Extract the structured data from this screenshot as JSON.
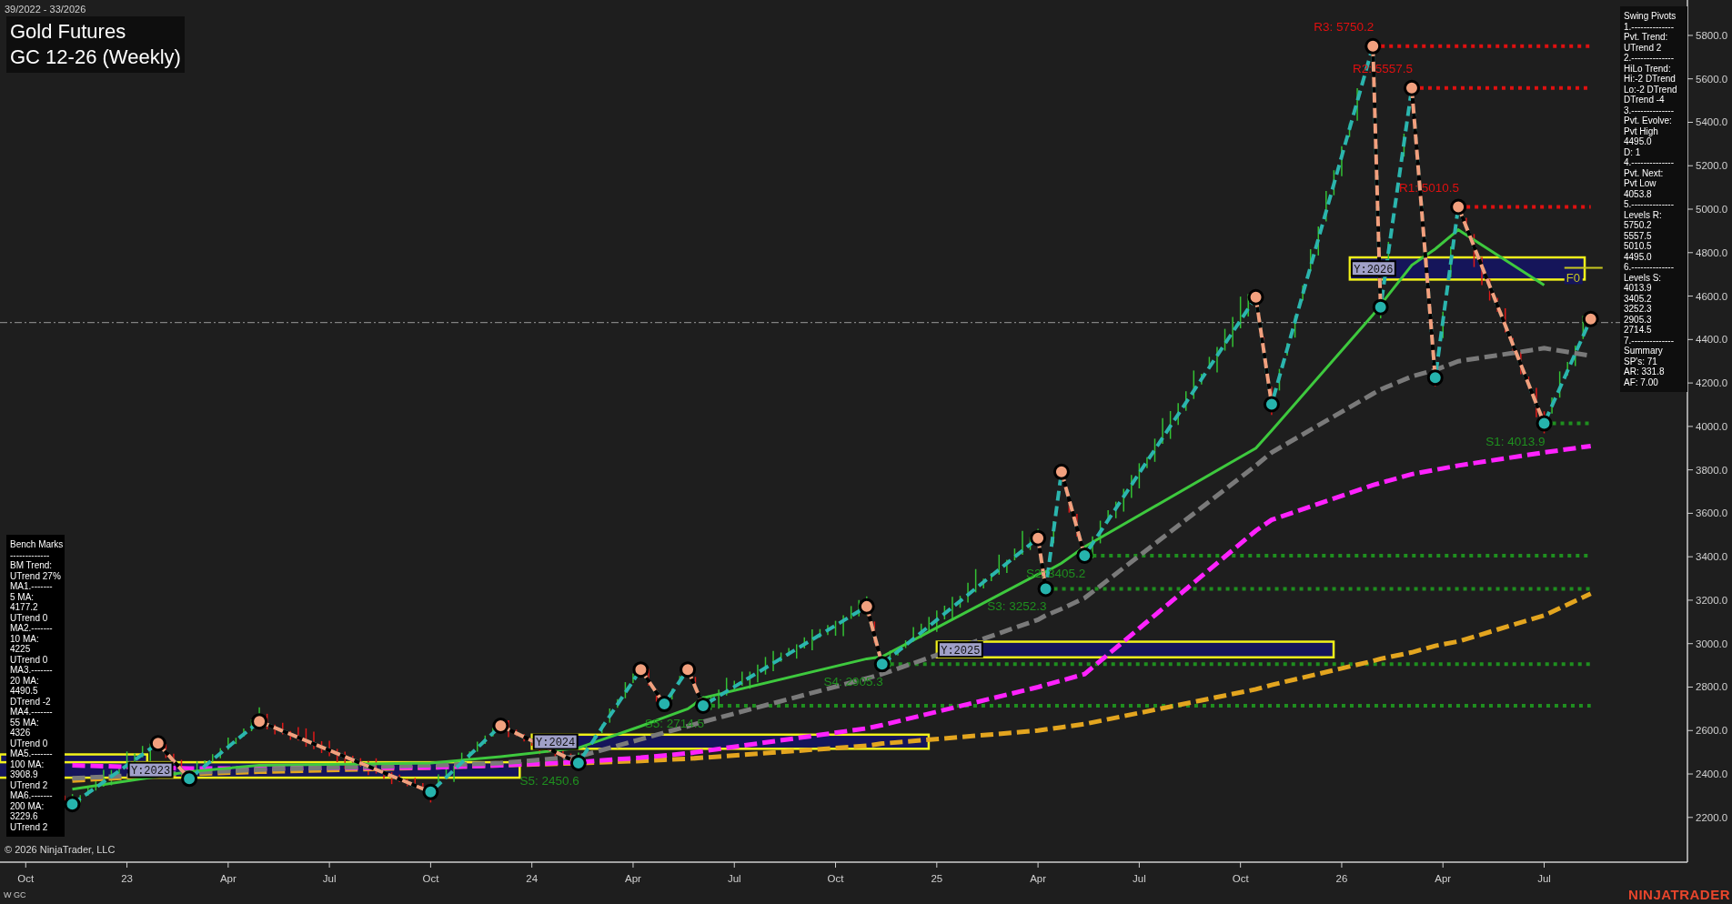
{
  "date_range": "39/2022 - 33/2026",
  "title": {
    "name": "Gold Futures",
    "contract": "GC 12-26 (Weekly)"
  },
  "swing_pivots": [
    "Swing Pivots",
    "1.--------------",
    "Pvt. Trend:",
    "UTrend 2",
    "2.--------------",
    "HiLo Trend:",
    "Hi:-2 DTrend",
    "Lo:-2 DTrend",
    "DTrend -4",
    "3.--------------",
    "Pvt. Evolve:",
    "Pvt High",
    "4495.0",
    "D: 1",
    "4.--------------",
    "Pvt. Next:",
    "Pvt Low",
    "4053.8",
    "5.--------------",
    "Levels R:",
    "5750.2",
    "5557.5",
    "5010.5",
    "4495.0",
    "6.--------------",
    "Levels S:",
    "4013.9",
    "3405.2",
    "3252.3",
    "2905.3",
    "2714.5",
    "7.--------------",
    "Summary",
    "SP's: 71",
    "AR: 331.8",
    "AF: 7.00"
  ],
  "bench_marks": [
    "Bench Marks",
    "-------------",
    "BM Trend:",
    "UTrend 27%",
    "MA1.-------",
    "5 MA:",
    "4177.2",
    "UTrend 0",
    "MA2.-------",
    "10 MA:",
    "4225",
    "UTrend 0",
    "MA3.-------",
    "20 MA:",
    "4490.5",
    "DTrend -2",
    "MA4.-------",
    "55 MA:",
    "4326",
    "UTrend 0",
    "MA5.-------",
    "100 MA:",
    "3908.9",
    "UTrend 2",
    "MA6.-------",
    "200 MA:",
    "3229.6",
    "UTrend 2"
  ],
  "chart": {
    "chart_data": {
      "type": "line",
      "x": [
        22.865,
        23.077,
        23.154,
        23.327,
        23.75,
        23.923,
        24.115,
        24.269,
        24.327,
        24.385,
        24.423,
        24.827,
        24.865,
        25.25,
        25.269,
        25.308,
        25.365,
        25.788,
        25.827,
        26.077,
        26.096,
        26.173,
        26.231,
        26.288,
        26.5,
        26.615
      ],
      "series": [
        {
          "color": "#2bb5ae",
          "line_style": "dashed",
          "marker": "o",
          "values": [
            2261,
            2541,
            2378,
            2642,
            2317,
            2622,
            2450.6,
            2881,
            2722,
            2881,
            2714.5,
            3171,
            2905.3,
            3486,
            3252.3,
            3791,
            3405.2,
            4595,
            4102,
            5750.2,
            4549,
            5557.5,
            4224,
            5010.5,
            4013.9,
            4495
          ]
        },
        {
          "color": "#3ec93e",
          "line_style": "solid",
          "values": [
            2330,
            null,
            2410,
            2440,
            2450,
            2480,
            2520,
            2620,
            2660,
            2700,
            2750,
            2930,
            2940,
            3320,
            3330,
            3370,
            3446,
            3900,
            3980,
            4513,
            4560,
            4742,
            4817,
            4905,
            4650,
            null
          ]
        },
        {
          "color": "#7a7a7a",
          "line_style": "dashed",
          "values": [
            2380,
            null,
            2405,
            2420,
            2440,
            2450,
            2480,
            2560,
            2590,
            2620,
            2640,
            2840,
            2860,
            3110,
            3130,
            3160,
            3210,
            3820,
            3880,
            4150,
            4170,
            4230,
            4260,
            4300,
            4360,
            4325
          ]
        },
        {
          "color": "#ff22ff",
          "line_style": "dashed",
          "values": [
            2440,
            null,
            2425,
            null,
            2430,
            2440,
            2455,
            2475,
            2485,
            2495,
            2505,
            2610,
            2625,
            2800,
            2810,
            2830,
            2860,
            3520,
            3570,
            3730,
            3740,
            3780,
            3800,
            3820,
            3880,
            3910
          ]
        },
        {
          "color": "#e3a51f",
          "line_style": "dashed",
          "values": [
            2370,
            null,
            2400,
            2410,
            2430,
            2440,
            2450,
            2460,
            2465,
            2470,
            2475,
            2530,
            2540,
            2600,
            2605,
            2615,
            2630,
            2790,
            2810,
            2920,
            2930,
            2960,
            2990,
            3010,
            3130,
            3230
          ]
        }
      ],
      "ref_lines": [
        {
          "axis": "y",
          "value": 4478,
          "color": "#9a9a9a",
          "line_style": "dashdot"
        }
      ],
      "xlim": [
        22.6865,
        26.8538
      ],
      "ylim": [
        1994,
        5963
      ],
      "xticks": [
        {
          "value": 22.75,
          "label": "Oct"
        },
        {
          "value": 23,
          "label": "23"
        },
        {
          "value": 23.25,
          "label": "Apr"
        },
        {
          "value": 23.5,
          "label": "Jul"
        },
        {
          "value": 23.75,
          "label": "Oct"
        },
        {
          "value": 24,
          "label": "24"
        },
        {
          "value": 24.25,
          "label": "Apr"
        },
        {
          "value": 24.5,
          "label": "Jul"
        },
        {
          "value": 24.75,
          "label": "Oct"
        },
        {
          "value": 25,
          "label": "25"
        },
        {
          "value": 25.25,
          "label": "Apr"
        },
        {
          "value": 25.5,
          "label": "Jul"
        },
        {
          "value": 25.75,
          "label": "Oct"
        },
        {
          "value": 26,
          "label": "26"
        },
        {
          "value": 26.25,
          "label": "Apr"
        },
        {
          "value": 26.5,
          "label": "Jul"
        }
      ],
      "yticks": [
        {
          "value": 2200,
          "label": "2200.0"
        },
        {
          "value": 2400,
          "label": "2400.0"
        },
        {
          "value": 2600,
          "label": "2600.0"
        },
        {
          "value": 2800,
          "label": "2800.0"
        },
        {
          "value": 3000,
          "label": "3000.0"
        },
        {
          "value": 3200,
          "label": "3200.0"
        },
        {
          "value": 3400,
          "label": "3400.0"
        },
        {
          "value": 3600,
          "label": "3600.0"
        },
        {
          "value": 3800,
          "label": "3800.0"
        },
        {
          "value": 4000,
          "label": "4000.0"
        },
        {
          "value": 4200,
          "label": "4200.0"
        },
        {
          "value": 4400,
          "label": "4400.0"
        },
        {
          "value": 4600,
          "label": "4600.0"
        },
        {
          "value": 4800,
          "label": "4800.0"
        },
        {
          "value": 5000,
          "label": "5000.0"
        },
        {
          "value": 5200,
          "label": "5200.0"
        },
        {
          "value": 5400,
          "label": "5400.0"
        },
        {
          "value": 5600,
          "label": "5600.0"
        },
        {
          "value": 5800,
          "label": "5800.0"
        }
      ],
      "annotations": [
        "Y:2023",
        "Y:2024",
        "Y:2025",
        "Y:2026",
        "F0",
        {
          "text": "R3: 5750.2",
          "x": 26.077,
          "y": 5750.2
        },
        {
          "text": "R2: 5557.5",
          "x": 26.173,
          "y": 5557.5
        },
        {
          "text": "R1: 5010.5",
          "x": 26.288,
          "y": 5010.5
        },
        {
          "text": "S1: 4013.9",
          "x": 26.5,
          "y": 4013.9
        },
        {
          "text": "S2: 3405.2",
          "x": 25.365,
          "y": 3405.2
        },
        {
          "text": "S3: 3252.3",
          "x": 25.269,
          "y": 3252.3
        },
        {
          "text": "S4: 2905.3",
          "x": 24.865,
          "y": 2905.3
        },
        {
          "text": "S5: 2714.5",
          "x": 24.423,
          "y": 2714.5
        },
        {
          "text": "S5: 2450.6",
          "x": 24.115,
          "y": 2450.6
        }
      ]
    }
  },
  "copyright": "© 2026 NinjaTrader, LLC",
  "instrument": "W GC",
  "brand": "NINJATRADER"
}
